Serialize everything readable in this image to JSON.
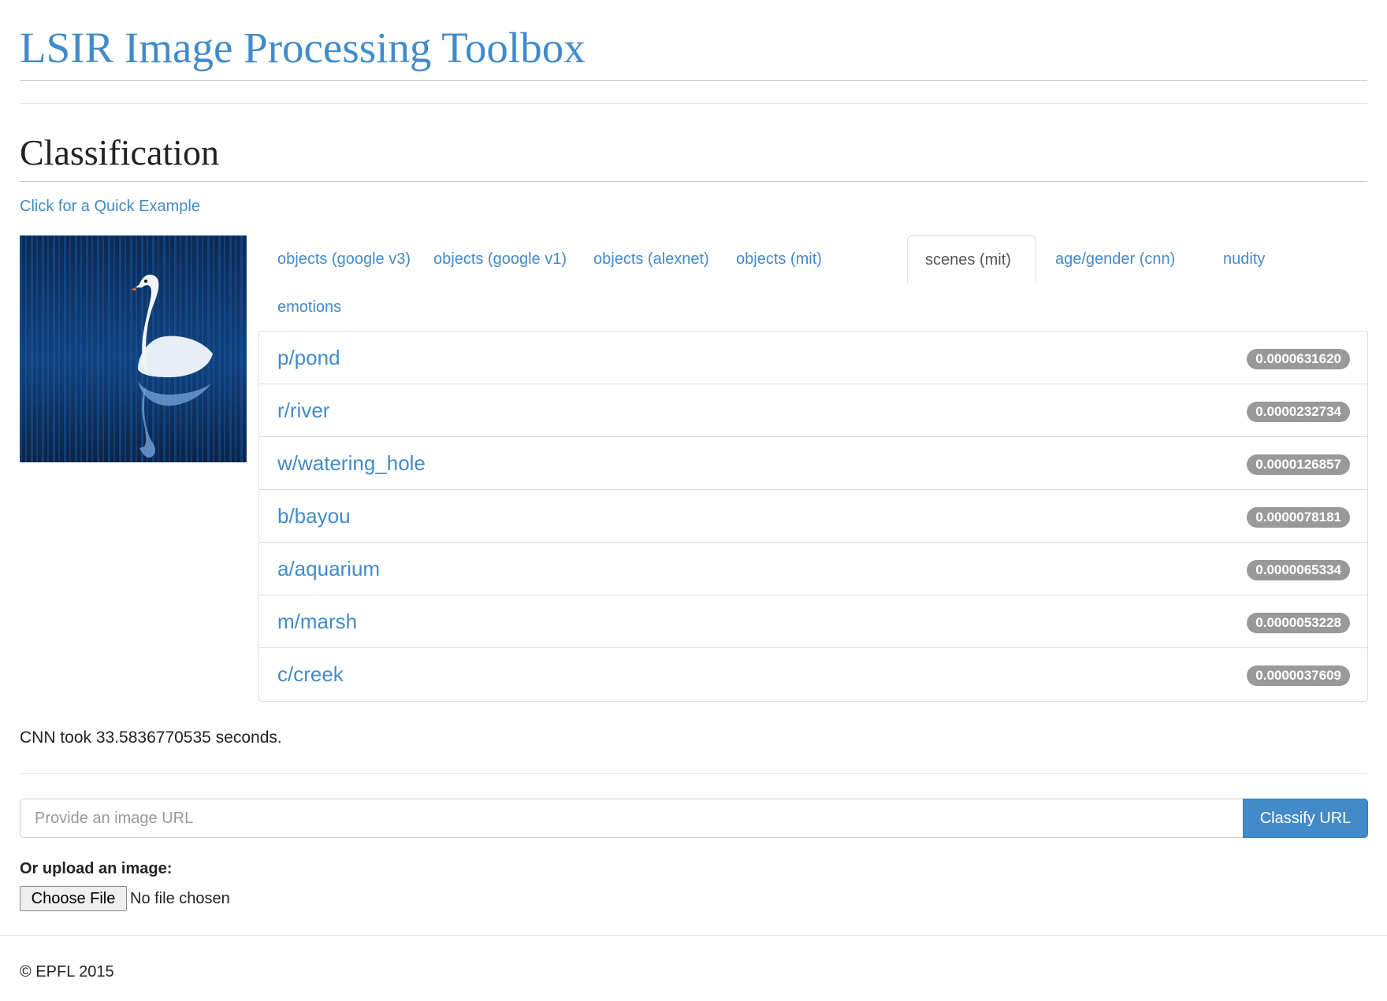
{
  "app": {
    "title": "LSIR Image Processing Toolbox"
  },
  "section": {
    "title": "Classification",
    "quick_example": "Click for a Quick Example"
  },
  "tabs": [
    {
      "label": "objects (google v3)",
      "active": false
    },
    {
      "label": "objects (google v1)",
      "active": false
    },
    {
      "label": "objects (alexnet)",
      "active": false
    },
    {
      "label": "objects (mit)",
      "active": false
    },
    {
      "label": "scenes (mit)",
      "active": true
    },
    {
      "label": "age/gender (cnn)",
      "active": false
    },
    {
      "label": "nudity",
      "active": false
    },
    {
      "label": "emotions",
      "active": false
    }
  ],
  "results": [
    {
      "label": "p/pond",
      "score": "0.0000631620"
    },
    {
      "label": "r/river",
      "score": "0.0000232734"
    },
    {
      "label": "w/watering_hole",
      "score": "0.0000126857"
    },
    {
      "label": "b/bayou",
      "score": "0.0000078181"
    },
    {
      "label": "a/aquarium",
      "score": "0.0000065334"
    },
    {
      "label": "m/marsh",
      "score": "0.0000053228"
    },
    {
      "label": "c/creek",
      "score": "0.0000037609"
    }
  ],
  "timing": "CNN took 33.5836770535 seconds.",
  "url_form": {
    "placeholder": "Provide an image URL",
    "value": "",
    "button_label": "Classify URL"
  },
  "upload": {
    "label": "Or upload an image:",
    "button_label": "Choose File",
    "status": "No file chosen"
  },
  "footer": {
    "copyright": "© EPFL 2015"
  },
  "colors": {
    "link": "#428bca",
    "badge": "#999999",
    "primary_button": "#428bca"
  }
}
